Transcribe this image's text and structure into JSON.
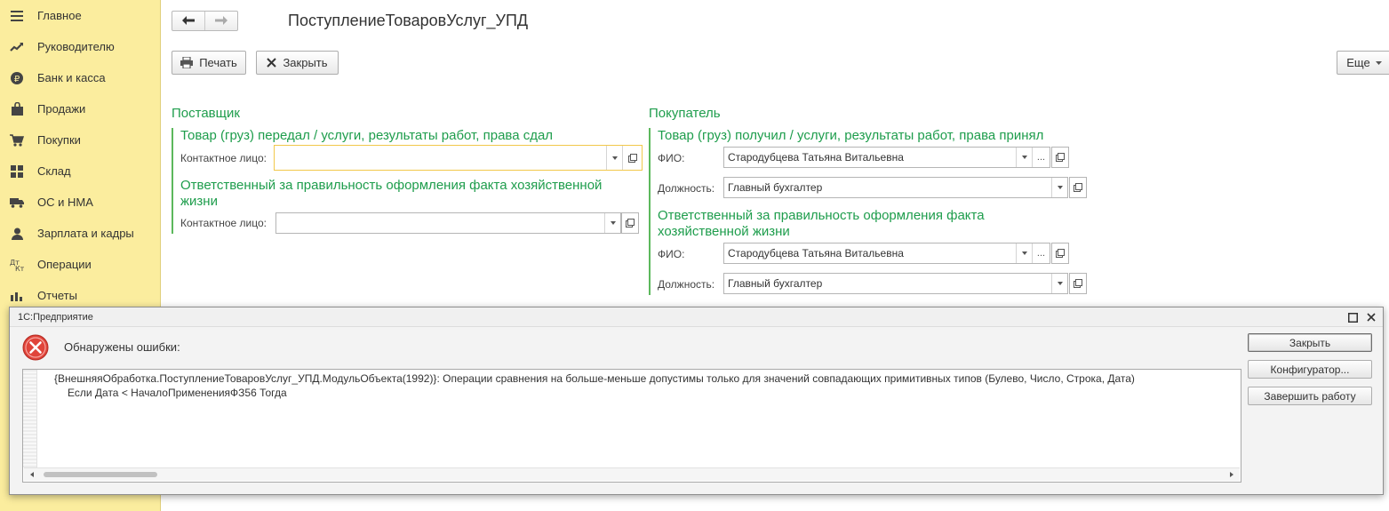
{
  "sidebar": {
    "items": [
      {
        "label": "Главное",
        "icon": "menu-lines-icon"
      },
      {
        "label": "Руководителю",
        "icon": "trend-chart-icon"
      },
      {
        "label": "Банк и касса",
        "icon": "ruble-coin-icon"
      },
      {
        "label": "Продажи",
        "icon": "shopping-bag-icon"
      },
      {
        "label": "Покупки",
        "icon": "shopping-cart-icon"
      },
      {
        "label": "Склад",
        "icon": "warehouse-grid-icon"
      },
      {
        "label": "ОС и НМА",
        "icon": "truck-icon"
      },
      {
        "label": "Зарплата и кадры",
        "icon": "person-icon"
      },
      {
        "label": "Операции",
        "icon": "debit-credit-icon"
      },
      {
        "label": "Отчеты",
        "icon": "bar-chart-icon"
      }
    ]
  },
  "header": {
    "title": "ПоступлениеТоваровУслуг_УПД"
  },
  "toolbar": {
    "print_label": "Печать",
    "close_label": "Закрыть",
    "more_label": "Еще"
  },
  "supplier": {
    "section_title": "Поставщик",
    "group1_title": "Товар (груз) передал / услуги, результаты работ, права сдал",
    "group1_contact_label": "Контактное лицо:",
    "group1_contact_value": "",
    "group2_title_line1": "Ответственный за правильность оформления факта хозяйственной",
    "group2_title_line2": "жизни",
    "group2_contact_label": "Контактное лицо:",
    "group2_contact_value": ""
  },
  "buyer": {
    "section_title": "Покупатель",
    "group1_title": "Товар (груз) получил / услуги, результаты работ, права принял",
    "group1_fio_label": "ФИО:",
    "group1_fio_value": "Стародубцева Татьяна Витальевна",
    "group1_position_label": "Должность:",
    "group1_position_value": "Главный бухгалтер",
    "group2_title_line1": "Ответственный за правильность оформления факта",
    "group2_title_line2": "хозяйственной жизни",
    "group2_fio_label": "ФИО:",
    "group2_fio_value": "Стародубцева Татьяна Витальевна",
    "group2_position_label": "Должность:",
    "group2_position_value": "Главный бухгалтер"
  },
  "dialog": {
    "title": "1С:Предприятие",
    "heading": "Обнаружены ошибки:",
    "message_line1": "{ВнешняяОбработка.ПоступлениеТоваровУслуг_УПД.МодульОбъекта(1992)}: Операции сравнения на больше-меньше допустимы только для значений совпадающих примитивных типов (Булево, Число, Строка, Дата)",
    "message_line2": "Если Дата < НачалоПримененияФЗ56 Тогда",
    "close_label": "Закрыть",
    "configurator_label": "Конфигуратор...",
    "exit_label": "Завершить работу"
  },
  "colors": {
    "sidebar_bg": "#fbed9e",
    "section_green": "#1e9d4c",
    "focus_yellow": "#f2c84b",
    "error_red": "#e0443a"
  }
}
